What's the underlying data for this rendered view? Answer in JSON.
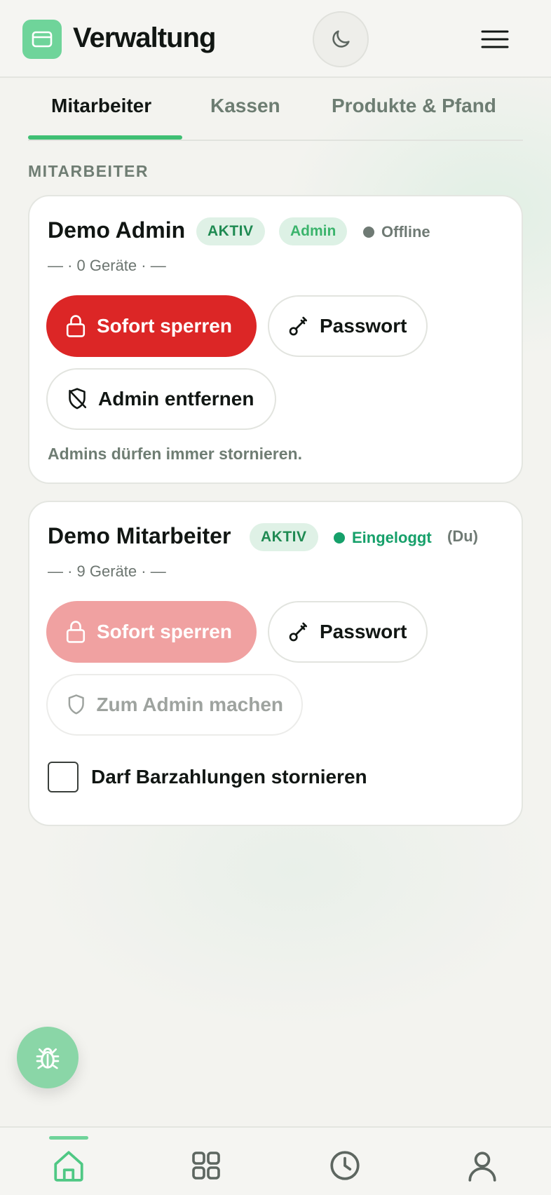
{
  "header": {
    "title": "Verwaltung",
    "logo_icon": "card-icon",
    "theme_icon": "moon-icon",
    "menu_icon": "hamburger-menu-icon"
  },
  "tabs": [
    {
      "label": "Mitarbeiter",
      "active": true
    },
    {
      "label": "Kassen",
      "active": false
    },
    {
      "label": "Produkte & Pfand",
      "active": false
    }
  ],
  "section_label": "MITARBEITER",
  "employees": [
    {
      "name": "Demo Admin",
      "status_badge": "AKTIV",
      "role_badge": "Admin",
      "presence": "Offline",
      "meta": "— · 0 Geräte · —",
      "lock_button": "Sofort sperren",
      "password_button": "Passwort",
      "role_button": "Admin entfernen",
      "note": "Admins dürfen immer stornieren."
    },
    {
      "name": "Demo Mitarbeiter",
      "status_badge": "AKTIV",
      "presence": "Eingeloggt",
      "self_marker": "(Du)",
      "meta": "— · 9 Geräte · —",
      "lock_button": "Sofort sperren",
      "password_button": "Passwort",
      "role_button": "Zum Admin machen",
      "checkbox_label": "Darf Barzahlungen stornieren",
      "checkbox_checked": false
    }
  ],
  "fab_icon": "bug-icon",
  "bottom_nav": [
    {
      "icon": "home-icon",
      "active": true
    },
    {
      "icon": "grid-icon",
      "active": false
    },
    {
      "icon": "clock-icon",
      "active": false
    },
    {
      "icon": "user-icon",
      "active": false
    }
  ],
  "colors": {
    "accent": "#3fbf73",
    "danger": "#dc2626",
    "online": "#16a06a",
    "offline": "#6f7a74"
  }
}
